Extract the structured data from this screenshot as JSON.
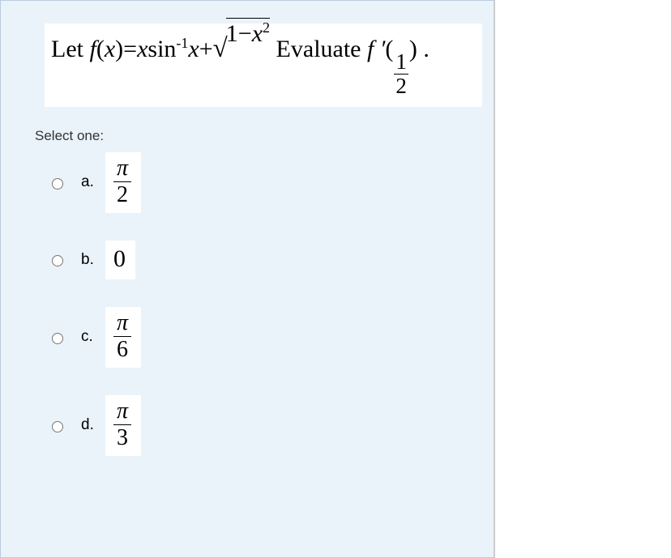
{
  "question": {
    "prefix": "Let  ",
    "middle": " Evaluate ",
    "suffix": " .",
    "f": "f",
    "x": "x",
    "lparen": "(",
    "rparen": ")",
    "eq": "=",
    "sin": "sin",
    "neg1": "-1",
    "plus": "+",
    "sqrt": "√",
    "one": "1",
    "minus": "−",
    "sq": "2",
    "fprime": "f ′",
    "half_num": "1",
    "half_den": "2"
  },
  "prompt": "Select one:",
  "options": {
    "a": {
      "label": "a.",
      "num": "π",
      "den": "2"
    },
    "b": {
      "label": "b.",
      "value": "0"
    },
    "c": {
      "label": "c.",
      "num": "π",
      "den": "6"
    },
    "d": {
      "label": "d.",
      "num": "π",
      "den": "3"
    }
  }
}
